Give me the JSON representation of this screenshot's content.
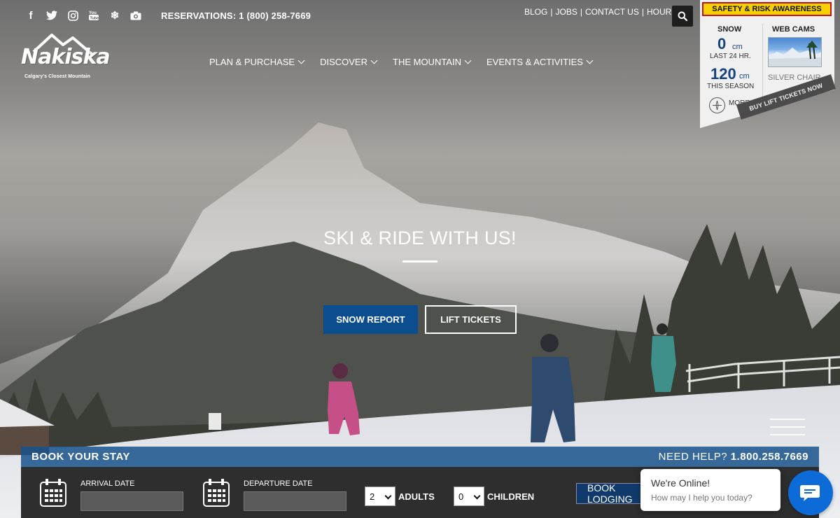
{
  "topbar": {
    "social": [
      {
        "name": "facebook-icon",
        "glyph": "f"
      },
      {
        "name": "twitter-icon",
        "glyph": "t"
      },
      {
        "name": "instagram-icon",
        "glyph": "◎"
      },
      {
        "name": "youtube-icon",
        "glyph": "▶"
      },
      {
        "name": "snowflake-icon",
        "glyph": "❄"
      },
      {
        "name": "camera-icon",
        "glyph": "▣"
      }
    ],
    "reservations": "RESERVATIONS: 1 (800) 258-7669",
    "links": [
      "BLOG",
      "JOBS",
      "CONTACT US",
      "HOURS"
    ]
  },
  "logo": {
    "word": "Nakiska",
    "tagline": "Calgary's Closest Mountain"
  },
  "nav": [
    {
      "label": "PLAN & PURCHASE"
    },
    {
      "label": "DISCOVER"
    },
    {
      "label": "THE MOUNTAIN"
    },
    {
      "label": "EVENTS & ACTIVITIES"
    }
  ],
  "widget": {
    "safety": "SAFETY & RISK AWARENESS",
    "snow_heading": "SNOW",
    "last24_value": "0",
    "last24_unit": "cm",
    "last24_label": "LAST 24 HR.",
    "season_value": "120",
    "season_unit": "cm",
    "season_label": "THIS SEASON",
    "more": "MORE",
    "webcams_heading": "WEB CAMS",
    "webcam_caption": "SILVER CHAIR",
    "ribbon": "BUY LIFT TICKETS NOW"
  },
  "hero": {
    "title": "SKI & RIDE WITH US!",
    "snow_report": "SNOW REPORT",
    "lift_tickets": "LIFT TICKETS"
  },
  "booking": {
    "title": "BOOK YOUR STAY",
    "help_label": "NEED HELP?",
    "help_phone": "1.800.258.7669",
    "arrival_label": "ARRIVAL DATE",
    "departure_label": "DEPARTURE DATE",
    "adults_value": "2",
    "adults_label": "ADULTS",
    "children_value": "0",
    "children_label": "CHILDREN",
    "book_button": "BOOK LODGING"
  },
  "chat": {
    "status": "We're Online!",
    "prompt": "How may I help you today?"
  },
  "colors": {
    "brand_blue": "#0c4d90",
    "safety_yellow": "#f6d000",
    "chat_blue": "#0d6bd8"
  }
}
